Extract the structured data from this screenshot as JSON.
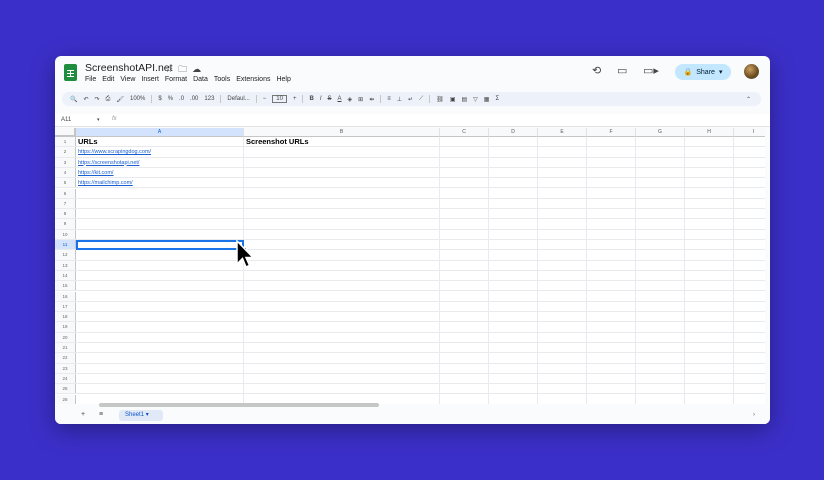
{
  "header": {
    "title": "ScreenshotAPI.net",
    "title_icons": [
      "star-icon",
      "folder-icon",
      "cloud-icon"
    ],
    "menu": [
      "File",
      "Edit",
      "View",
      "Insert",
      "Format",
      "Data",
      "Tools",
      "Extensions",
      "Help"
    ],
    "share_label": "Share",
    "accent": "#c2e7ff"
  },
  "toolbar": {
    "zoom": "100%",
    "currency": "$",
    "percent": "%",
    "decimal_less": ".0",
    "decimal_more": ".00",
    "number_format": "123",
    "font": "Defaul...",
    "font_size": "10"
  },
  "formula_bar": {
    "name_box": "A11",
    "fx": "fx"
  },
  "columns": [
    "A",
    "B",
    "C",
    "D",
    "E",
    "F",
    "G",
    "H",
    "I"
  ],
  "rows": [
    "1",
    "2",
    "3",
    "4",
    "5",
    "6",
    "7",
    "8",
    "9",
    "10",
    "11",
    "12",
    "13",
    "14",
    "15",
    "16",
    "17",
    "18",
    "19",
    "20",
    "21",
    "22",
    "23",
    "24",
    "25",
    "26"
  ],
  "cells": {
    "A1": "URLs",
    "B1": "Screenshot URLs",
    "A2": "https://www.scrapingdog.com/",
    "A3": "https://screenshotapi.net/",
    "A4": "https://kit.com/",
    "A5": "https://mailchimp.com/"
  },
  "selected_cell": "A11",
  "sheets": [
    "Sheet1"
  ]
}
